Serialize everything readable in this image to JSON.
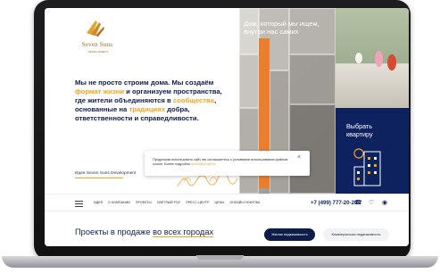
{
  "brand": {
    "title": "Seven Suns",
    "subtitle": "DEVELOPMENT",
    "accent": "#f2a31b",
    "navy": "#0d1d48"
  },
  "hero": {
    "part1": "Мы не просто строим дома. Мы создаём ",
    "hl1": "формат жизни",
    "part2": " и организуем пространства, где жители объединяются в ",
    "hl2": "сообщества",
    "part3": ", основанные на ",
    "hl3": "традициях",
    "part4": " добра, ответственности и справедливости.",
    "link": "Идея Seven Suns Development"
  },
  "photo": {
    "caption": "Дом, который мы ищем, внутри нас самих"
  },
  "card": {
    "title": "Выбрать квартиру"
  },
  "cookie": {
    "text": "Продолжая использовать сайт, вы соглашаетесь с условиями использования файлов cookie. Более подробно ",
    "link": "политика сайта",
    "close": "×"
  },
  "nav": {
    "items": [
      "ИДЕЯ",
      "О КОМПАНИИ",
      "ПРОЕКТЫ",
      "СВЕТЛЫЙ РОУ",
      "ПРЕСС-ЦЕНТР",
      "ЦЕНЫ",
      "ОНЛАЙН-ПОКУПКА"
    ],
    "phone": "+7 (499) 777-20-20",
    "icons": [
      "phone-icon",
      "heart-icon",
      "user-icon"
    ]
  },
  "projects": {
    "title_prefix": "Проекты в продаже ",
    "title_link": "во всех городах",
    "colon": ":",
    "tabs": [
      "Жилая недвижимость",
      "Коммерческая недвижимость"
    ]
  }
}
